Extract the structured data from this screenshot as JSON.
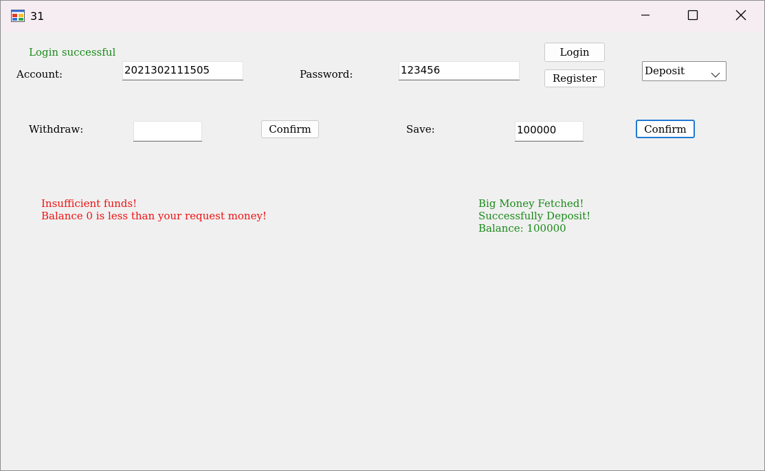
{
  "window": {
    "title": "31",
    "icon": "app-window-icon",
    "controls": {
      "minimize": "minimize-icon",
      "maximize": "maximize-icon",
      "close": "close-icon"
    }
  },
  "login": {
    "status_text": "Login successful",
    "status_color": "#1a8a1a",
    "account_label": "Account:",
    "account_value": "2021302111505",
    "password_label": "Password:",
    "password_value": "123456",
    "login_button": "Login",
    "register_button": "Register"
  },
  "mode_select": {
    "selected": "Deposit"
  },
  "withdraw": {
    "label": "Withdraw:",
    "value": "",
    "confirm_button": "Confirm",
    "messages": [
      "Insufficient funds!",
      "Balance 0 is less than your request money!"
    ],
    "message_color": "#ee1111"
  },
  "save": {
    "label": "Save:",
    "value": "100000",
    "confirm_button": "Confirm",
    "messages": [
      "Big Money Fetched!",
      "Successfully Deposit!",
      "Balance: 100000"
    ],
    "message_color": "#1a8a1a"
  }
}
